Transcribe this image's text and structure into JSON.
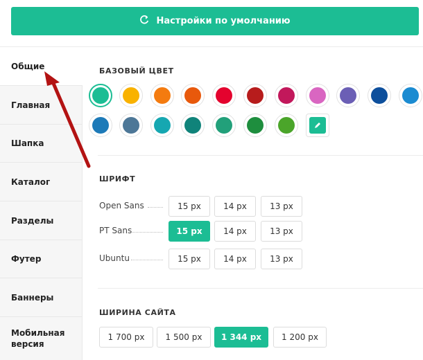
{
  "top_button": {
    "label": "Настройки по умолчанию",
    "icon": "refresh-icon"
  },
  "sidebar": {
    "items": [
      {
        "label": "Общие",
        "active": true
      },
      {
        "label": "Главная"
      },
      {
        "label": "Шапка"
      },
      {
        "label": "Каталог"
      },
      {
        "label": "Разделы"
      },
      {
        "label": "Футер"
      },
      {
        "label": "Баннеры"
      },
      {
        "label": "Мобильная версия"
      }
    ]
  },
  "base_color": {
    "title": "БАЗОВЫЙ ЦВЕТ",
    "colors": [
      "#1cbd94",
      "#f9b200",
      "#f47b0f",
      "#e8590c",
      "#e4032e",
      "#b71c1c",
      "#c2185b",
      "#d966c1",
      "#6b5fb5",
      "#0d4f9c",
      "#1b8bd1",
      "#1d7ab8",
      "#4d7797",
      "#16a7b1",
      "#10837a",
      "#22a07a",
      "#1e8e3e",
      "#4ba52a"
    ],
    "selected": "#1cbd94",
    "custom_icon": "pencil-icon"
  },
  "font": {
    "title": "ШРИФТ",
    "rows": [
      {
        "name": "Open Sans",
        "sizes": [
          "15 px",
          "14 px",
          "13 px"
        ],
        "active": -1
      },
      {
        "name": "PT Sans",
        "sizes": [
          "15 px",
          "14 px",
          "13 px"
        ],
        "active": 0
      },
      {
        "name": "Ubuntu",
        "sizes": [
          "15 px",
          "14 px",
          "13 px"
        ],
        "active": -1
      }
    ]
  },
  "site_width": {
    "title": "ШИРИНА САЙТА",
    "options": [
      "1 700 px",
      "1 500 px",
      "1 344 px",
      "1 200 px"
    ],
    "active": 2
  }
}
